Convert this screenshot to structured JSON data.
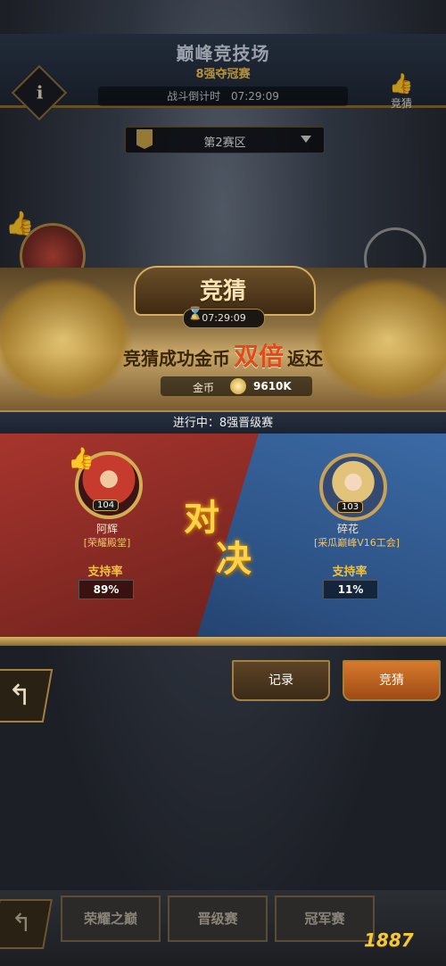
{
  "header": {
    "title": "巅峰竞技场",
    "subtitle": "8强夺冠赛",
    "countdown_label": "战斗倒计时",
    "countdown_value": "07:29:09",
    "guess_label": "竞猜"
  },
  "zone": {
    "selected": "第2赛区"
  },
  "side": {
    "left_level": "104",
    "right_level": "103"
  },
  "modal": {
    "title": "竞猜",
    "timer": "07:29:09",
    "slogan_pre": "竞猜成功金币",
    "slogan_big": "双倍",
    "slogan_post": "返还",
    "gold_label": "金币",
    "gold_value": "9610K"
  },
  "match": {
    "status": "进行中：8强晋级赛",
    "vs_1": "对",
    "vs_2": "决",
    "left": {
      "name": "阿辉",
      "guild": "[荣耀殿堂]",
      "level": "104",
      "support_label": "支持率",
      "support_pct": "89%"
    },
    "right": {
      "name": "碎花",
      "guild": "[采瓜巅峰V16工会]",
      "level": "103",
      "support_label": "支持率",
      "support_pct": "11%"
    }
  },
  "tabs": {
    "record": "记录",
    "guess": "竞猜"
  },
  "nav": {
    "tab1": "荣耀之巅",
    "tab2": "晋级赛",
    "tab3": "冠军赛"
  },
  "watermark": "1887",
  "colors": {
    "accent_gold": "#f0c040",
    "red_side": "#a7352d",
    "blue_side": "#3b6aa5",
    "highlight": "#e04b1d"
  }
}
